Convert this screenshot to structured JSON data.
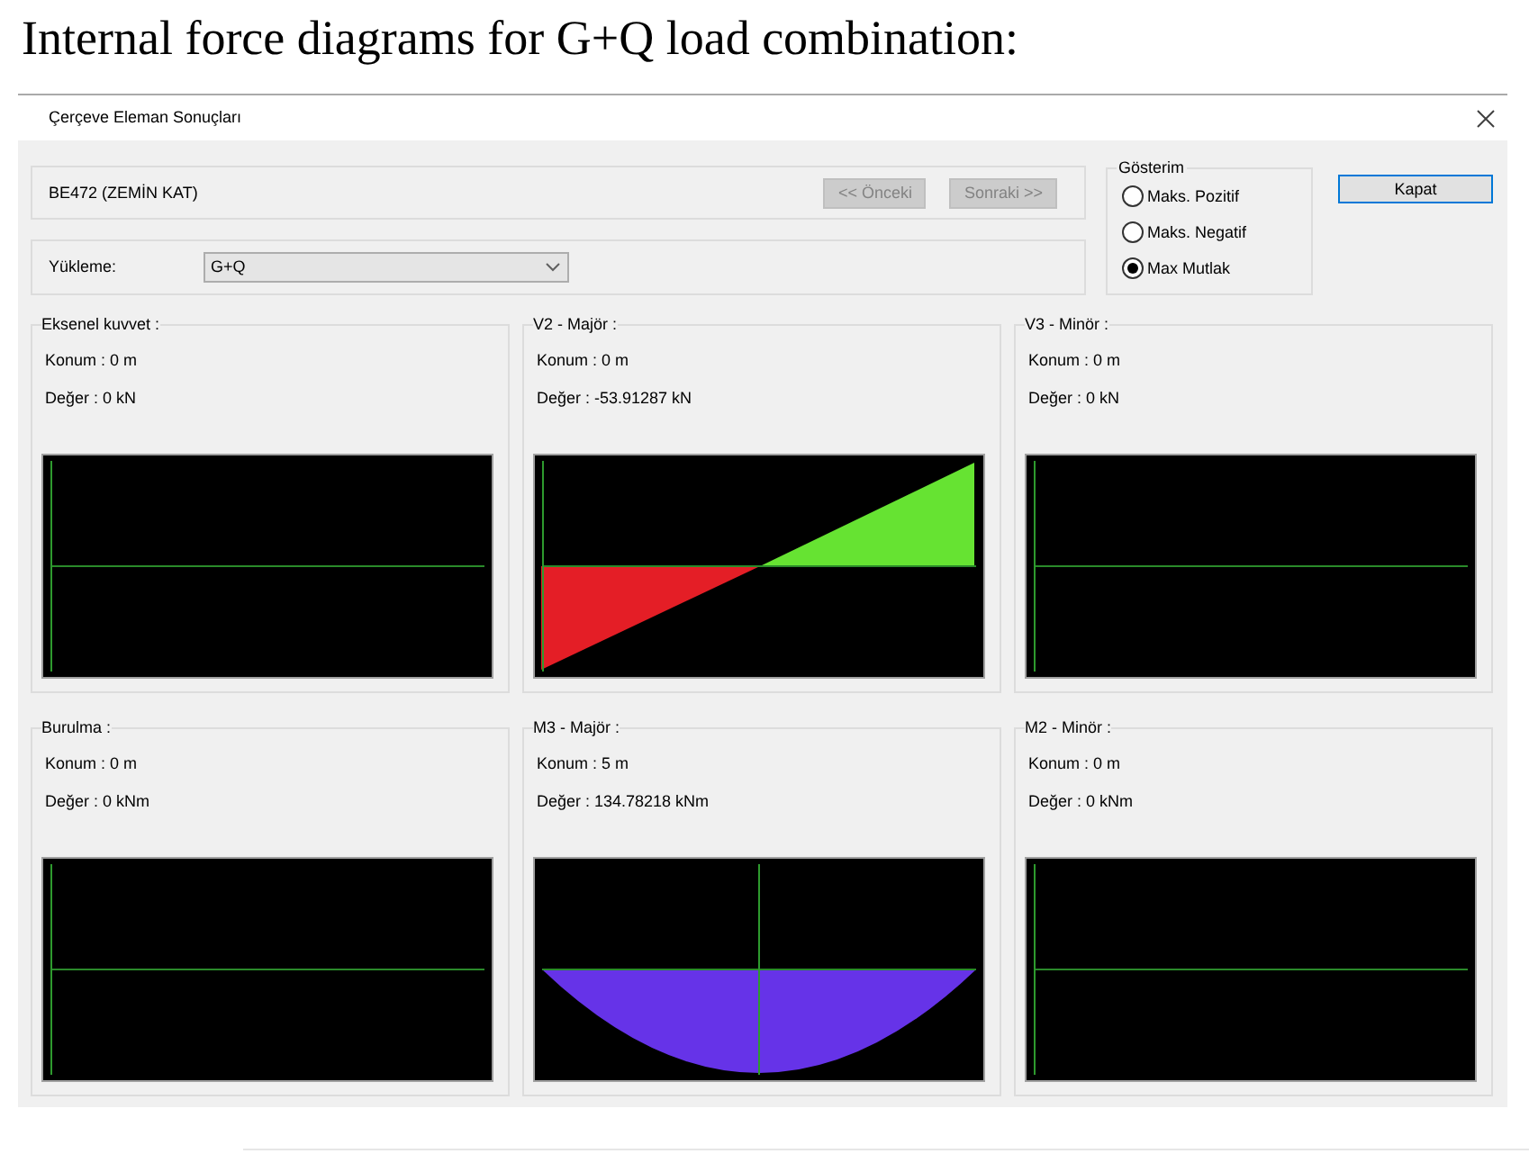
{
  "heading": "Internal force diagrams for G+Q load combination:",
  "window": {
    "title": "Çerçeve Eleman Sonuçları"
  },
  "element": {
    "name": "BE472 (ZEMİN KAT)",
    "buttons": [
      {
        "label": "<< Önceki",
        "disabled": true
      },
      {
        "label": "Sonraki >>",
        "disabled": true
      }
    ]
  },
  "loading": {
    "label": "Yükleme:",
    "value": "G+Q"
  },
  "display": {
    "title": "Gösterim",
    "options": [
      {
        "label": "Maks. Pozitif",
        "selected": false
      },
      {
        "label": "Maks. Negatif",
        "selected": false
      },
      {
        "label": "Max Mutlak",
        "selected": true
      }
    ]
  },
  "close_button": {
    "label": "Kapat"
  },
  "diagrams": [
    {
      "title": "Eksenel kuvvet :",
      "position": "Konum : 0 m",
      "value": "Değer : 0 kN",
      "kind": "empty",
      "marker_centered": false
    },
    {
      "title": "V2 - Majör :",
      "position": "Konum : 0 m",
      "value": "Değer : -53.91287 kN",
      "kind": "linear",
      "marker_centered": false
    },
    {
      "title": "V3 - Minör :",
      "position": "Konum : 0 m",
      "value": "Değer : 0 kN",
      "kind": "empty",
      "marker_centered": false
    },
    {
      "title": "Burulma :",
      "position": "Konum : 0 m",
      "value": "Değer : 0 kNm",
      "kind": "empty",
      "marker_centered": false
    },
    {
      "title": "M3 - Majör :",
      "position": "Konum : 5 m",
      "value": "Değer : 134.78218 kNm",
      "kind": "parabolic",
      "marker_centered": true
    },
    {
      "title": "M2 - Minör :",
      "position": "Konum : 0 m",
      "value": "Değer : 0 kNm",
      "kind": "empty",
      "marker_centered": false
    }
  ]
}
